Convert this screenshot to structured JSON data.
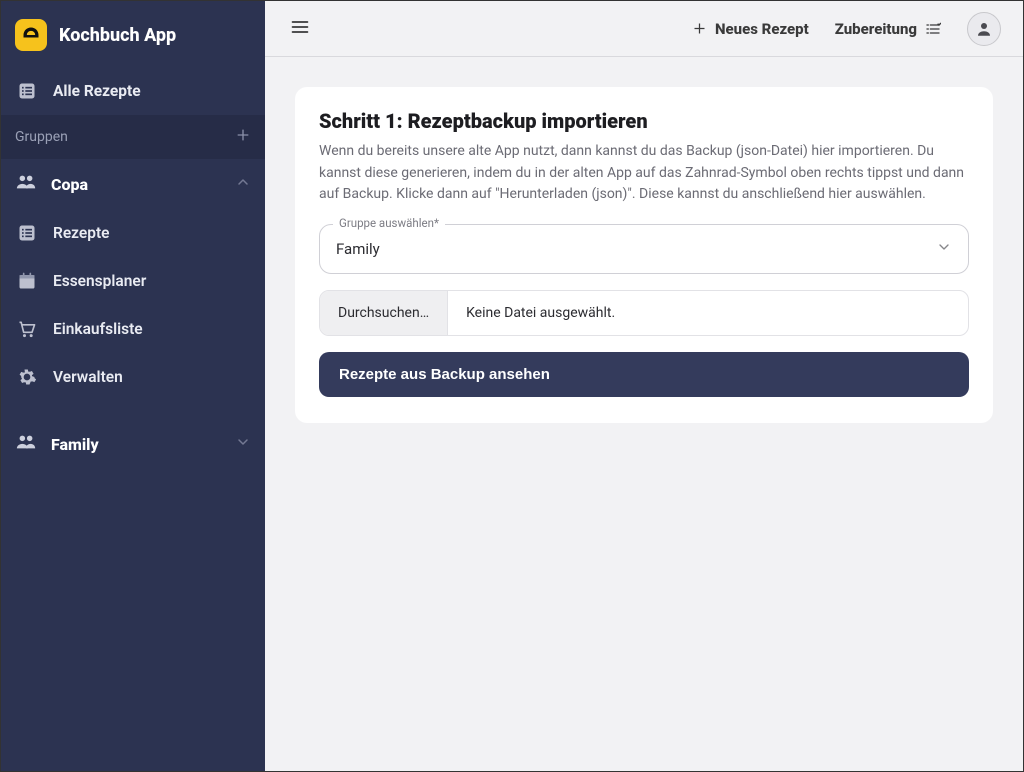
{
  "app": {
    "title": "Kochbuch App"
  },
  "sidebar": {
    "all_recipes": "Alle Rezepte",
    "groups_label": "Gruppen",
    "group1": {
      "name": "Copa",
      "items": {
        "recipes": "Rezepte",
        "meal_planner": "Essensplaner",
        "shopping_list": "Einkaufsliste",
        "manage": "Verwalten"
      }
    },
    "group2": {
      "name": "Family"
    }
  },
  "topbar": {
    "new_recipe": "Neues Rezept",
    "preparation": "Zubereitung"
  },
  "page": {
    "title": "Schritt 1: Rezeptbackup importieren",
    "description": "Wenn du bereits unsere alte App nutzt, dann kannst du das Backup (json-Datei) hier importieren. Du kannst diese generieren, indem du in der alten App auf das Zahnrad-Symbol oben rechts tippst und dann auf Backup. Klicke dann auf \"Herunterladen (json)\". Diese kannst du anschließend hier auswählen.",
    "group_select": {
      "label": "Gruppe auswählen*",
      "value": "Family"
    },
    "file": {
      "button": "Durchsuchen…",
      "status": "Keine Datei ausgewählt."
    },
    "submit": "Rezepte aus Backup ansehen"
  }
}
